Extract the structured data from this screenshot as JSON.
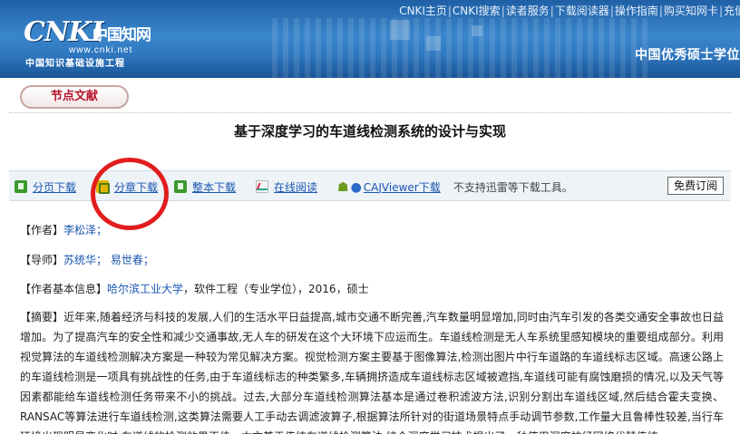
{
  "header": {
    "logo_text": "CNKI",
    "logo_cn": "中国知网",
    "logo_url": "www.cnki.net",
    "logo_subtitle": "中国知识基础设施工程",
    "top_links": [
      "CNKI主页",
      "CNKI搜索",
      "读者服务",
      "下载阅读器",
      "操作指南",
      "购买知网卡",
      "充值"
    ],
    "banner_title": "中国优秀硕士学位"
  },
  "section": {
    "label": "节点文献"
  },
  "document": {
    "title": "基于深度学习的车道线检测系统的设计与实现"
  },
  "toolbar": {
    "items": [
      {
        "label": "分页下载",
        "icon": "green-download-icon"
      },
      {
        "label": "分章下载",
        "icon": "yellow-download-icon"
      },
      {
        "label": "整本下载",
        "icon": "green-book-icon"
      },
      {
        "label": "在线阅读",
        "icon": "chart-read-icon"
      },
      {
        "label": "CAJViewer下载",
        "icon": "android-apple-icon"
      }
    ],
    "note": "不支持迅雷等下载工具。",
    "subscribe": "免费订阅"
  },
  "meta": {
    "author_label": "【作者】",
    "author": "李松泽；",
    "advisor_label": "【导师】",
    "advisor_1": "苏统华；",
    "advisor_2": "易世春；",
    "info_label": "【作者基本信息】",
    "institution": "哈尔滨工业大学",
    "info_rest": "，软件工程（专业学位），2016，硕士"
  },
  "abstract": {
    "label": "【摘要】",
    "text": "近年来,随着经济与科技的发展,人们的生活水平日益提高,城市交通不断完善,汽车数量明显增加,同时由汽车引发的各类交通安全事故也日益增加。为了提高汽车的安全性和减少交通事故,无人车的研发在这个大环境下应运而生。车道线检测是无人车系统里感知模块的重要组成部分。利用视觉算法的车道线检测解决方案是一种较为常见解决方案。视觉检测方案主要基于图像算法,检测出图片中行车道路的车道线标志区域。高速公路上的车道线检测是一项具有挑战性的任务,由于车道线标志的种类繁多,车辆拥挤造成车道线标志区域被遮挡,车道线可能有腐蚀磨损的情况,以及天气等因素都能给车道线检测任务带来不小的挑战。过去,大部分车道线检测算法基本是通过卷积滤波方法,识别分割出车道线区域,然后结合霍夫变换、RANSAC等算法进行车道线检测,这类算法需要人工手动去调滤波算子,根据算法所针对的街道场景特点手动调节参数,工作量大且鲁棒性较差,当行车环境出现明显变化时,车道线的检测效果不佳。本文基于传统车道线检测算法,结合深度学习技术提出了一种使用深度神经网络代替传统"
  },
  "colors": {
    "banner": "#2f78c0",
    "link": "#1a56b0",
    "accent_red": "#e21d1d",
    "section_text": "#b3142a"
  }
}
